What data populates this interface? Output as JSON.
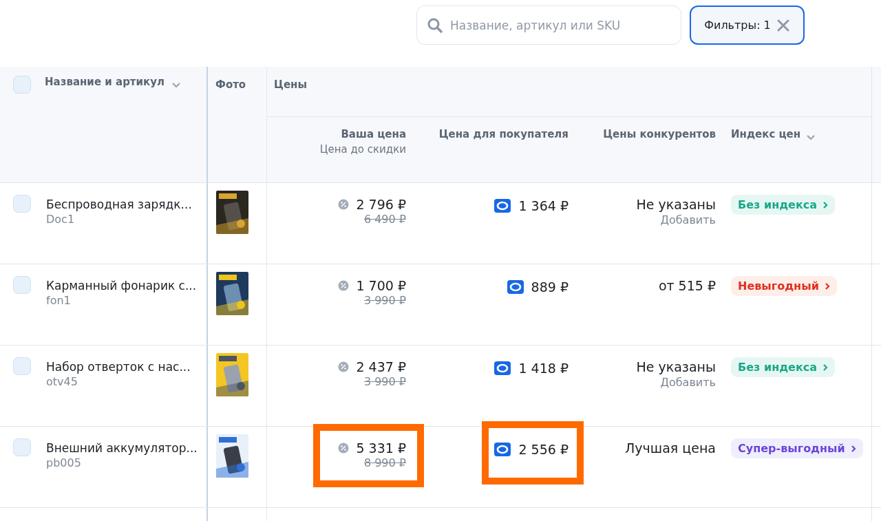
{
  "search": {
    "placeholder": "Название, артикул или SKU"
  },
  "filter_button": {
    "label": "Фильтры: 1",
    "active": true
  },
  "table": {
    "select_all": {
      "checked": false
    },
    "columns": {
      "name": "Название и артикул",
      "photo": "Фото",
      "prices": "Цены",
      "your_price": "Ваша цена",
      "your_price_sub": "Цена до скидки",
      "buyer_price": "Цена для покупателя",
      "competitors": "Цены конкурентов",
      "index": "Индекс цен"
    },
    "rows": [
      {
        "checked": false,
        "name": "Беспроводная зарядк...",
        "sku": "Doc1",
        "price": "2 796 ₽",
        "old_price": "6 490 ₽",
        "buyer_price": "1 364 ₽",
        "competitors": "Не указаны",
        "competitors_link": "Добавить",
        "index": {
          "label": "Без индекса",
          "kind": "none"
        },
        "highlighted": false
      },
      {
        "checked": false,
        "name": "Карманный фонарик с...",
        "sku": "fon1",
        "price": "1 700 ₽",
        "old_price": "3 990 ₽",
        "buyer_price": "889 ₽",
        "competitors": "от 515 ₽",
        "index": {
          "label": "Невыгодный",
          "kind": "bad"
        },
        "highlighted": false
      },
      {
        "checked": false,
        "name": "Набор отверток с нас...",
        "sku": "otv45",
        "price": "2 437 ₽",
        "old_price": "3 990 ₽",
        "buyer_price": "1 418 ₽",
        "competitors": "Не указаны",
        "competitors_link": "Добавить",
        "index": {
          "label": "Без индекса",
          "kind": "none"
        },
        "highlighted": false
      },
      {
        "checked": false,
        "name": "Внешний аккумулятор...",
        "sku": "pb005",
        "price": "5 331 ₽",
        "old_price": "8 990 ₽",
        "buyer_price": "2 556 ₽",
        "competitors": "Лучшая цена",
        "index": {
          "label": "Супер-выгодный",
          "kind": "super"
        },
        "highlighted": true
      }
    ]
  }
}
